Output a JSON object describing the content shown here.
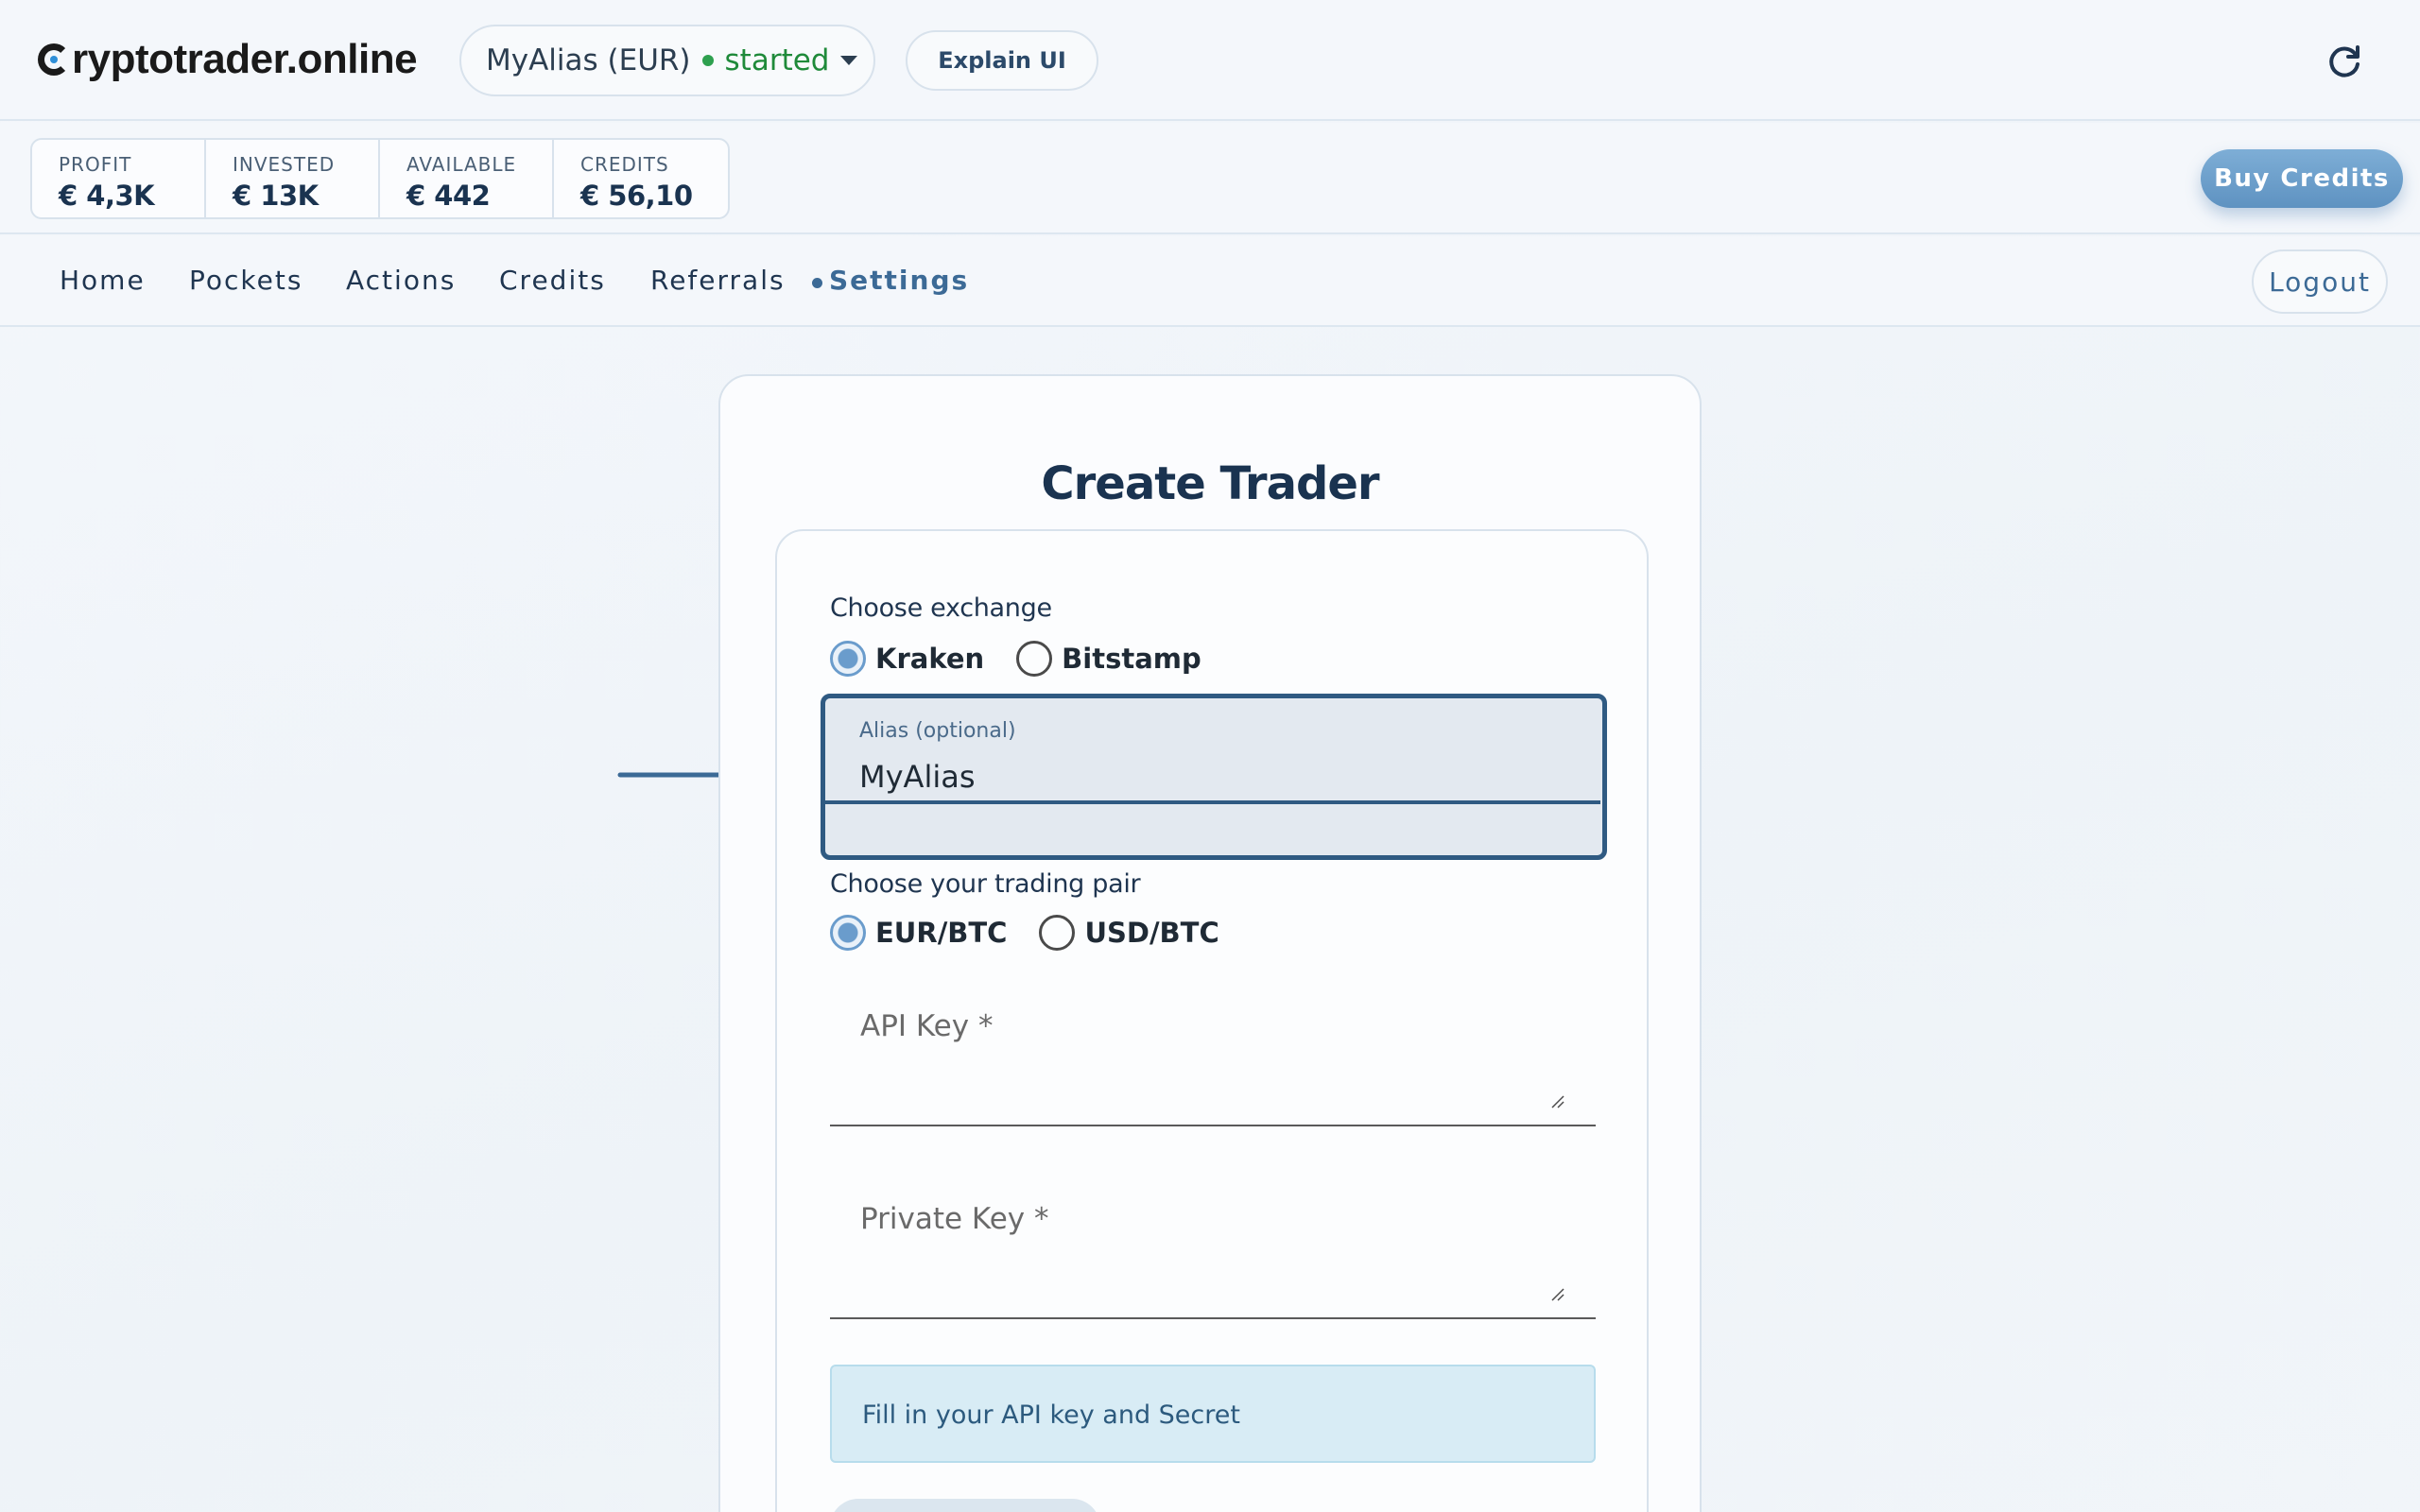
{
  "header": {
    "logo_text": "ryptotrader.online",
    "trader_select": {
      "alias": "MyAlias (EUR)",
      "status": "started"
    },
    "explain_button": "Explain UI",
    "refresh_icon": "refresh-icon"
  },
  "stats": [
    {
      "label": "PROFIT",
      "value": "€ 4,3K"
    },
    {
      "label": "INVESTED",
      "value": "€ 13K"
    },
    {
      "label": "AVAILABLE",
      "value": "€ 442"
    },
    {
      "label": "CREDITS",
      "value": "€ 56,10"
    }
  ],
  "buy_credits_label": "Buy Credits",
  "nav": {
    "items": [
      "Home",
      "Pockets",
      "Actions",
      "Credits",
      "Referrals",
      "Settings"
    ],
    "active": "Settings",
    "logout_label": "Logout"
  },
  "form": {
    "title": "Create Trader",
    "exchange_label": "Choose exchange",
    "exchanges": [
      "Kraken",
      "Bitstamp"
    ],
    "selected_exchange": "Kraken",
    "alias_label": "Alias (optional)",
    "alias_value": "MyAlias",
    "pair_label": "Choose your trading pair",
    "pairs": [
      "EUR/BTC",
      "USD/BTC"
    ],
    "selected_pair": "EUR/BTC",
    "api_key_label": "API Key *",
    "private_key_label": "Private Key *",
    "info_message": "Fill in your API key and Secret"
  },
  "colors": {
    "accent": "#3c6a96",
    "status_green": "#2ea04f",
    "buy_button": "#6a9ccc",
    "alert_bg": "#d8ecf5"
  }
}
